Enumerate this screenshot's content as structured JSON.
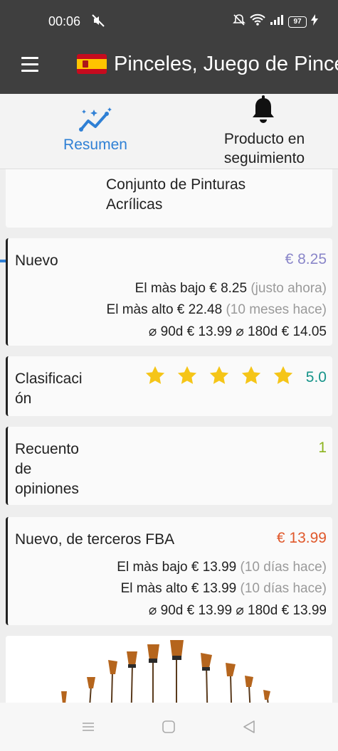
{
  "status_bar": {
    "time": "00:06",
    "battery": "97"
  },
  "app_bar": {
    "title": "Pinceles, Juego de Pinceles de Pintura"
  },
  "tabs": [
    {
      "label": "Resumen"
    },
    {
      "label_line1": "Producto en",
      "label_line2": "seguimiento"
    }
  ],
  "product_card": {
    "line1": "Conjunto de Pinturas",
    "line2": "Acrílicas"
  },
  "new_card": {
    "label": "Nuevo",
    "price": "€ 8.25",
    "lowest_label": "El màs bajo",
    "lowest_value": "€ 8.25",
    "lowest_when": "(justo ahora)",
    "highest_label": "El màs alto",
    "highest_value": "€ 22.48",
    "highest_when": "(10 meses hace)",
    "avg90_label": "⌀ 90d",
    "avg90_value": "€ 13.99",
    "avg180_label": "⌀ 180d",
    "avg180_value": "€ 14.05"
  },
  "rating_card": {
    "label_line1": "Clasificaci",
    "label_line2": "ón",
    "value": "5.0",
    "stars": 5
  },
  "count_card": {
    "label_line1": "Recuento",
    "label_line2": "de",
    "label_line3": "opiniones",
    "value": "1"
  },
  "fba_card": {
    "label": "Nuevo, de terceros FBA",
    "price": "€ 13.99",
    "lowest_label": "El màs bajo",
    "lowest_value": "€ 13.99",
    "lowest_when": "(10 días hace)",
    "highest_label": "El màs alto",
    "highest_value": "€ 13.99",
    "highest_when": "(10 días hace)",
    "avg90_label": "⌀ 90d",
    "avg90_value": "€ 13.99",
    "avg180_label": "⌀ 180d",
    "avg180_value": "€ 13.99"
  },
  "colors": {
    "accent": "#2f80d5",
    "new": "#8a86c9",
    "rating": "#16948a",
    "count": "#8cb41e",
    "fba": "#e0582b",
    "star": "#f5c518"
  }
}
